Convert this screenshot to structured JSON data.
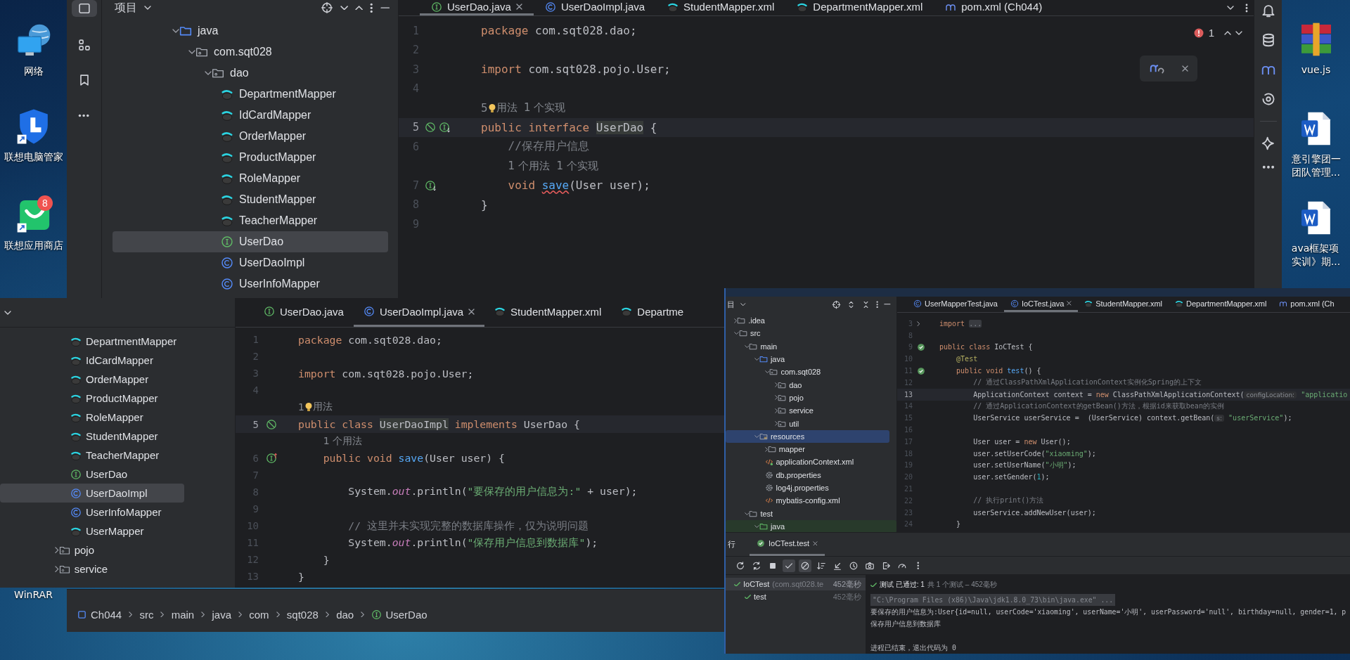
{
  "desktop_icons": [
    {
      "kind": "network",
      "label": [
        "网络"
      ]
    },
    {
      "kind": "shield",
      "label": [
        "联想电脑管家"
      ]
    },
    {
      "kind": "store",
      "label": [
        "联想应用商店"
      ],
      "badge": "8"
    },
    {
      "kind": "covered",
      "label": [
        "WinRAR"
      ]
    },
    {
      "kind": "archive",
      "label": [
        "vue.js"
      ]
    },
    {
      "kind": "document",
      "label": [
        "意引擎团一",
        "团队管理..."
      ]
    },
    {
      "kind": "document",
      "label": [
        "ava框架项",
        "实训》期..."
      ]
    }
  ],
  "top_window": {
    "tool_strip": [
      {
        "kind": "project",
        "selected": true
      },
      {
        "kind": "structure",
        "selected": false
      },
      {
        "kind": "bookmarks",
        "selected": false
      },
      {
        "kind": "more",
        "selected": false
      }
    ],
    "project_title": "项目",
    "tree": [
      {
        "label": "java",
        "kind": "source-folder",
        "expanded": true,
        "selected": false,
        "children": [
          {
            "label": "com.sqt028",
            "kind": "package",
            "expanded": true,
            "selected": false,
            "children": [
              {
                "label": "dao",
                "kind": "package",
                "expanded": true,
                "selected": false,
                "children": [
                  {
                    "label": "DepartmentMapper",
                    "kind": "mapper",
                    "selected": false
                  },
                  {
                    "label": "IdCardMapper",
                    "kind": "mapper",
                    "selected": false
                  },
                  {
                    "label": "OrderMapper",
                    "kind": "mapper",
                    "selected": false
                  },
                  {
                    "label": "ProductMapper",
                    "kind": "mapper",
                    "selected": false
                  },
                  {
                    "label": "RoleMapper",
                    "kind": "mapper",
                    "selected": false
                  },
                  {
                    "label": "StudentMapper",
                    "kind": "mapper",
                    "selected": false
                  },
                  {
                    "label": "TeacherMapper",
                    "kind": "mapper",
                    "selected": false
                  },
                  {
                    "label": "UserDao",
                    "kind": "interface",
                    "selected": true
                  },
                  {
                    "label": "UserDaoImpl",
                    "kind": "class",
                    "selected": false
                  },
                  {
                    "label": "UserInfoMapper",
                    "kind": "class",
                    "selected": false
                  }
                ]
              }
            ]
          }
        ]
      }
    ],
    "tabs": [
      {
        "label": "UserDao.java",
        "kind": "interface",
        "selected": true
      },
      {
        "label": "UserDaoImpl.java",
        "kind": "class",
        "selected": false
      },
      {
        "label": "StudentMapper.xml",
        "kind": "mapper",
        "selected": false
      },
      {
        "label": "DepartmentMapper.xml",
        "kind": "mapper",
        "selected": false
      },
      {
        "label": "pom.xml (Ch044)",
        "kind": "maven",
        "selected": false
      }
    ],
    "problems": "1",
    "lines": [
      {
        "kind": "code",
        "no": "1",
        "current": false,
        "tokens": [
          {
            "kind": "kw",
            "text": "package"
          },
          {
            "kind": "plain",
            "text": " com.sqt028.dao;"
          }
        ]
      },
      {
        "kind": "code",
        "no": "2",
        "current": false
      },
      {
        "kind": "code",
        "no": "3",
        "current": false,
        "tokens": [
          {
            "kind": "kw",
            "text": "import"
          },
          {
            "kind": "plain",
            "text": " com.sqt028.pojo.User;"
          }
        ]
      },
      {
        "kind": "code",
        "no": "4",
        "current": false
      },
      {
        "kind": "inlay",
        "current": false,
        "tokens": [
          {
            "kind": "hint",
            "text": "5"
          },
          {
            "kind": "bulb"
          },
          {
            "kind": "hint",
            "text": "用法  1 个实现"
          }
        ]
      },
      {
        "kind": "code",
        "no": "5",
        "current": true,
        "gutter": [
          {
            "kind": "slash"
          },
          {
            "kind": "impl-down"
          }
        ],
        "tokens": [
          {
            "kind": "kw",
            "text": "public interface "
          },
          {
            "kind": "highlight",
            "text": "UserDao"
          },
          {
            "kind": "plain",
            "text": " {"
          }
        ]
      },
      {
        "kind": "code",
        "no": "6",
        "current": false,
        "tokens": [
          {
            "kind": "comment",
            "text": "    //保存用户信息"
          }
        ]
      },
      {
        "kind": "inlay",
        "current": false,
        "tokens": [
          {
            "kind": "hint",
            "text": "1 个用法  1 个实现"
          }
        ]
      },
      {
        "kind": "code",
        "no": "7",
        "current": false,
        "gutter": [
          {
            "kind": "impl-down"
          }
        ],
        "tokens": [
          {
            "kind": "kw",
            "text": "    void "
          },
          {
            "kind": "error",
            "text": "save"
          },
          {
            "kind": "plain",
            "text": "(User user);"
          }
        ]
      },
      {
        "kind": "code",
        "no": "8",
        "current": false,
        "tokens": [
          {
            "kind": "plain",
            "text": "}"
          }
        ]
      },
      {
        "kind": "code",
        "no": "9",
        "current": false
      }
    ]
  },
  "left_window": {
    "tree": [
      {
        "children": [
          {
            "label": "DepartmentMapper",
            "kind": "mapper",
            "selected": false
          },
          {
            "label": "IdCardMapper",
            "kind": "mapper",
            "selected": false
          },
          {
            "label": "OrderMapper",
            "kind": "mapper",
            "selected": false
          },
          {
            "label": "ProductMapper",
            "kind": "mapper",
            "selected": false
          },
          {
            "label": "RoleMapper",
            "kind": "mapper",
            "selected": false
          },
          {
            "label": "StudentMapper",
            "kind": "mapper",
            "selected": false
          },
          {
            "label": "TeacherMapper",
            "kind": "mapper",
            "selected": false
          },
          {
            "label": "UserDao",
            "kind": "interface",
            "selected": false
          },
          {
            "label": "UserDaoImpl",
            "kind": "class",
            "selected": true
          },
          {
            "label": "UserInfoMapper",
            "kind": "class",
            "selected": false
          },
          {
            "label": "UserMapper",
            "kind": "mapper",
            "selected": false
          }
        ]
      },
      {
        "label": "pojo",
        "kind": "package",
        "expanded": false,
        "selected": false
      },
      {
        "label": "service",
        "kind": "package",
        "expanded": false,
        "selected": false
      }
    ],
    "tabs": [
      {
        "label": "UserDao.java",
        "kind": "interface",
        "selected": false
      },
      {
        "label": "UserDaoImpl.java",
        "kind": "class",
        "selected": true
      },
      {
        "label": "StudentMapper.xml",
        "kind": "mapper",
        "selected": false
      },
      {
        "label": "Departme",
        "kind": "mapper",
        "selected": false
      }
    ],
    "lines": [
      {
        "kind": "code",
        "no": "1",
        "current": false,
        "tokens": [
          {
            "kind": "kw",
            "text": "package"
          },
          {
            "kind": "plain",
            "text": " com.sqt028.dao;"
          }
        ]
      },
      {
        "kind": "code",
        "no": "2",
        "current": false
      },
      {
        "kind": "code",
        "no": "3",
        "current": false,
        "tokens": [
          {
            "kind": "kw",
            "text": "import"
          },
          {
            "kind": "plain",
            "text": " com.sqt028.pojo.User;"
          }
        ]
      },
      {
        "kind": "code",
        "no": "4",
        "current": false
      },
      {
        "kind": "inlay",
        "current": false,
        "tokens": [
          {
            "kind": "hint",
            "text": "1"
          },
          {
            "kind": "bulb"
          },
          {
            "kind": "hint",
            "text": "用法"
          }
        ]
      },
      {
        "kind": "code",
        "no": "5",
        "current": true,
        "gutter": [
          {
            "kind": "slash"
          }
        ],
        "tokens": [
          {
            "kind": "kw",
            "text": "public class "
          },
          {
            "kind": "highlight",
            "text": "UserDaoImpl"
          },
          {
            "kind": "kw",
            "text": " implements"
          },
          {
            "kind": "plain",
            "text": " UserDao {"
          }
        ]
      },
      {
        "kind": "inlay",
        "current": false,
        "tokens": [
          {
            "kind": "hint",
            "text": "1 个用法"
          }
        ]
      },
      {
        "kind": "code",
        "no": "6",
        "current": false,
        "gutter": [
          {
            "kind": "impl-up"
          }
        ],
        "tokens": [
          {
            "kind": "kw",
            "text": "    public void "
          },
          {
            "kind": "method",
            "text": "save"
          },
          {
            "kind": "plain",
            "text": "(User user) {"
          }
        ]
      },
      {
        "kind": "code",
        "no": "7",
        "current": false
      },
      {
        "kind": "code",
        "no": "8",
        "current": false,
        "tokens": [
          {
            "kind": "plain",
            "text": "        System."
          },
          {
            "kind": "static",
            "text": "out"
          },
          {
            "kind": "plain",
            "text": ".println("
          },
          {
            "kind": "string",
            "text": "\"要保存的用户信息为:\""
          },
          {
            "kind": "plain",
            "text": " + user);"
          }
        ]
      },
      {
        "kind": "code",
        "no": "9",
        "current": false
      },
      {
        "kind": "code",
        "no": "10",
        "current": false,
        "tokens": [
          {
            "kind": "comment",
            "text": "        // 这里并未实现完整的数据库操作，仅为说明问题"
          }
        ]
      },
      {
        "kind": "code",
        "no": "11",
        "current": false,
        "tokens": [
          {
            "kind": "plain",
            "text": "        System."
          },
          {
            "kind": "static",
            "text": "out"
          },
          {
            "kind": "plain",
            "text": ".println("
          },
          {
            "kind": "string",
            "text": "\"保存用户信息到数据库\""
          },
          {
            "kind": "plain",
            "text": ");"
          }
        ]
      },
      {
        "kind": "code",
        "no": "12",
        "current": false,
        "tokens": [
          {
            "kind": "plain",
            "text": "    }"
          }
        ]
      },
      {
        "kind": "code",
        "no": "13",
        "current": false,
        "tokens": [
          {
            "kind": "plain",
            "text": "}"
          }
        ]
      }
    ],
    "breadcrumb": [
      {
        "label": "Ch044",
        "kind": "module"
      },
      {
        "label": "src",
        "kind": "plain"
      },
      {
        "label": "main",
        "kind": "plain"
      },
      {
        "label": "java",
        "kind": "plain"
      },
      {
        "label": "com",
        "kind": "plain"
      },
      {
        "label": "sqt028",
        "kind": "plain"
      },
      {
        "label": "dao",
        "kind": "plain"
      },
      {
        "label": "UserDao",
        "kind": "interface"
      }
    ]
  },
  "right_window": {
    "project_title": "目",
    "tree": [
      {
        "label": ".idea",
        "kind": "folder",
        "expanded": false,
        "selected": false
      },
      {
        "label": "src",
        "kind": "folder",
        "expanded": true,
        "selected": false,
        "children": [
          {
            "label": "main",
            "kind": "folder",
            "expanded": true,
            "selected": false,
            "children": [
              {
                "label": "java",
                "kind": "source-folder",
                "expanded": true,
                "selected": false,
                "children": [
                  {
                    "label": "com.sqt028",
                    "kind": "package",
                    "expanded": true,
                    "selected": false,
                    "children": [
                      {
                        "label": "dao",
                        "kind": "package",
                        "expanded": false,
                        "selected": false
                      },
                      {
                        "label": "pojo",
                        "kind": "package",
                        "expanded": false,
                        "selected": false
                      },
                      {
                        "label": "service",
                        "kind": "package",
                        "expanded": false,
                        "selected": false
                      },
                      {
                        "label": "util",
                        "kind": "package",
                        "expanded": false,
                        "selected": false
                      }
                    ]
                  }
                ]
              },
              {
                "label": "resources",
                "kind": "resources-folder",
                "expanded": true,
                "selected": true,
                "children": [
                  {
                    "label": "mapper",
                    "kind": "folder",
                    "expanded": false,
                    "selected": false
                  },
                  {
                    "label": "applicationContext.xml",
                    "kind": "spring-xml",
                    "selected": false
                  },
                  {
                    "label": "db.properties",
                    "kind": "properties",
                    "selected": false
                  },
                  {
                    "label": "log4j.properties",
                    "kind": "properties",
                    "selected": false
                  },
                  {
                    "label": "mybatis-config.xml",
                    "kind": "xml",
                    "selected": false
                  }
                ]
              }
            ]
          },
          {
            "label": "test",
            "kind": "folder",
            "expanded": true,
            "selected": false,
            "children": [
              {
                "label": "java",
                "kind": "test-folder",
                "expanded": true,
                "selected": false
              }
            ]
          }
        ]
      }
    ],
    "tabs": [
      {
        "label": "UserMapperTest.java",
        "kind": "class",
        "selected": false
      },
      {
        "label": "IoCTest.java",
        "kind": "class",
        "selected": true
      },
      {
        "label": "StudentMapper.xml",
        "kind": "mapper",
        "selected": false
      },
      {
        "label": "DepartmentMapper.xml",
        "kind": "mapper",
        "selected": false
      },
      {
        "label": "pom.xml (Ch",
        "kind": "maven",
        "selected": false
      }
    ],
    "lines": [
      {
        "kind": "code",
        "no": "3",
        "current": false,
        "gutter": [
          {
            "kind": "fold"
          }
        ],
        "tokens": [
          {
            "kind": "kw",
            "text": "import "
          },
          {
            "kind": "fold",
            "text": "..."
          }
        ]
      },
      {
        "kind": "code",
        "no": "8",
        "current": false
      },
      {
        "kind": "code",
        "no": "9",
        "current": false,
        "gutter": [
          {
            "kind": "run-passed"
          }
        ],
        "tokens": [
          {
            "kind": "kw",
            "text": "public class"
          },
          {
            "kind": "plain",
            "text": " IoCTest {"
          }
        ]
      },
      {
        "kind": "code",
        "no": "10",
        "current": false,
        "tokens": [
          {
            "kind": "annotation",
            "text": "    @Test"
          }
        ]
      },
      {
        "kind": "code",
        "no": "11",
        "current": false,
        "gutter": [
          {
            "kind": "run-passed"
          }
        ],
        "tokens": [
          {
            "kind": "kw",
            "text": "    public void "
          },
          {
            "kind": "method",
            "text": "test"
          },
          {
            "kind": "plain",
            "text": "() {"
          }
        ]
      },
      {
        "kind": "code",
        "no": "12",
        "current": false,
        "tokens": [
          {
            "kind": "comment",
            "text": "        // 通过ClassPathXmlApplicationContext实例化Spring的上下文"
          }
        ]
      },
      {
        "kind": "code",
        "no": "13",
        "current": true,
        "tokens": [
          {
            "kind": "plain",
            "text": "        ApplicationContext context = "
          },
          {
            "kind": "kw",
            "text": "new"
          },
          {
            "kind": "plain",
            "text": " ClassPathXmlApplicationContext("
          },
          {
            "kind": "param",
            "text": "configLocation:"
          },
          {
            "kind": "string",
            "text": " \"applicatio"
          }
        ]
      },
      {
        "kind": "code",
        "no": "14",
        "current": false,
        "tokens": [
          {
            "kind": "comment",
            "text": "        // 通过ApplicationContext的getBean()方法，根据id来获取bean的实例"
          }
        ]
      },
      {
        "kind": "code",
        "no": "15",
        "current": false,
        "tokens": [
          {
            "kind": "plain",
            "text": "        UserService userService =  (UserService) context.getBean("
          },
          {
            "kind": "param",
            "text": "s:"
          },
          {
            "kind": "string",
            "text": " \"userService\""
          },
          {
            "kind": "plain",
            "text": ");"
          }
        ]
      },
      {
        "kind": "code",
        "no": "16",
        "current": false
      },
      {
        "kind": "code",
        "no": "17",
        "current": false,
        "tokens": [
          {
            "kind": "plain",
            "text": "        User user = "
          },
          {
            "kind": "kw",
            "text": "new"
          },
          {
            "kind": "plain",
            "text": " User();"
          }
        ]
      },
      {
        "kind": "code",
        "no": "18",
        "current": false,
        "tokens": [
          {
            "kind": "plain",
            "text": "        user.setUserCode("
          },
          {
            "kind": "string",
            "text": "\"xiaoming\""
          },
          {
            "kind": "plain",
            "text": ");"
          }
        ]
      },
      {
        "kind": "code",
        "no": "19",
        "current": false,
        "tokens": [
          {
            "kind": "plain",
            "text": "        user.setUserName("
          },
          {
            "kind": "string",
            "text": "\"小明\""
          },
          {
            "kind": "plain",
            "text": ");"
          }
        ]
      },
      {
        "kind": "code",
        "no": "20",
        "current": false,
        "tokens": [
          {
            "kind": "plain",
            "text": "        user.setGender("
          },
          {
            "kind": "number",
            "text": "1"
          },
          {
            "kind": "plain",
            "text": ");"
          }
        ]
      },
      {
        "kind": "code",
        "no": "21",
        "current": false
      },
      {
        "kind": "code",
        "no": "22",
        "current": false,
        "tokens": [
          {
            "kind": "comment",
            "text": "        // 执行print()方法"
          }
        ]
      },
      {
        "kind": "code",
        "no": "23",
        "current": false,
        "tokens": [
          {
            "kind": "plain",
            "text": "        userService.addNewUser(user);"
          }
        ]
      },
      {
        "kind": "code",
        "no": "24",
        "current": false,
        "tokens": [
          {
            "kind": "plain",
            "text": "    }"
          }
        ]
      }
    ],
    "run": {
      "title": "行",
      "tabs": [
        {
          "label": "IoCTest.test",
          "selected": true
        }
      ],
      "toolbar": [
        {
          "kind": "rerun",
          "on": false
        },
        {
          "kind": "toggle",
          "on": false
        },
        {
          "kind": "stop",
          "on": false
        },
        {
          "kind": "show-passed",
          "on": true
        },
        {
          "kind": "show-ignored",
          "on": true
        },
        {
          "kind": "sort",
          "on": false
        },
        {
          "kind": "import",
          "on": false
        },
        {
          "kind": "history",
          "on": false
        },
        {
          "kind": "camera",
          "on": false
        },
        {
          "kind": "export",
          "on": false
        },
        {
          "kind": "gauge",
          "on": false
        },
        {
          "kind": "more",
          "on": false
        }
      ],
      "tests": [
        {
          "label": "IoCTest",
          "detail": "(com.sqt028.te",
          "time": "452毫秒",
          "passed": true,
          "selected": true,
          "children": [
            {
              "label": "test",
              "time": "452毫秒",
              "passed": true,
              "selected": false
            }
          ]
        }
      ],
      "result": {
        "passed": true,
        "label": "测试 已通过: 1",
        "summary": "共 1 个测试 – 452毫秒"
      },
      "console": [
        {
          "kind": "command",
          "text": "\"C:\\Program Files (x86)\\Java\\jdk1.8.0_73\\bin\\java.exe\" ..."
        },
        {
          "kind": "output",
          "text": "要保存的用户信息为:User{id=null, userCode='xiaoming', userName='小明', userPassword='null', birthday=null, gender=1, p"
        },
        {
          "kind": "output",
          "text": "保存用户信息到数据库"
        },
        {
          "kind": "exit",
          "text": "进程已结束，退出代码为 0"
        }
      ]
    }
  }
}
